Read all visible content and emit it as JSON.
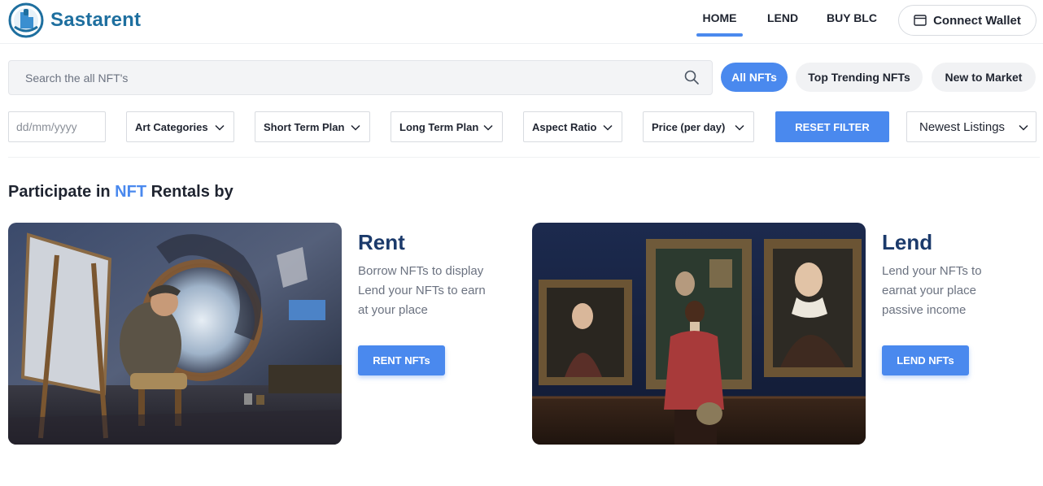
{
  "brand": {
    "name": "Sastarent"
  },
  "nav": {
    "home": "HOME",
    "lend": "LEND",
    "buy": "BUY BLC",
    "connect_wallet": "Connect Wallet"
  },
  "search": {
    "placeholder": "Search the all NFT's"
  },
  "tabs": {
    "all": "All NFTs",
    "trending": "Top Trending NFTs",
    "new": "New to Market"
  },
  "filters": {
    "date_placeholder": "dd/mm/yyyy",
    "art_categories": "Art Categories",
    "short_term": "Short Term Plan",
    "long_term": "Long Term Plan",
    "aspect_ratio": "Aspect Ratio",
    "price": "Price (per day)",
    "reset": "RESET FILTER",
    "sort": "Newest Listings"
  },
  "section": {
    "title_prefix": "Participate in ",
    "title_highlight": "NFT",
    "title_suffix": " Rentals by"
  },
  "rent": {
    "title": "Rent",
    "desc_lines": [
      "Borrow NFTs to display",
      "Lend your NFTs to earn",
      "at your place"
    ],
    "button": "RENT NFTs"
  },
  "lend": {
    "title": "Lend",
    "desc_lines": [
      "Lend your NFTs to",
      "earnat your place",
      "passive income"
    ],
    "button": "LEND NFTs"
  },
  "colors": {
    "accent": "#4a89ee",
    "brand": "#1e6f9f",
    "heading": "#1b3a6b"
  },
  "icons": {
    "search": "search-icon",
    "wallet": "wallet-icon",
    "chevron": "chevron-down-icon"
  }
}
